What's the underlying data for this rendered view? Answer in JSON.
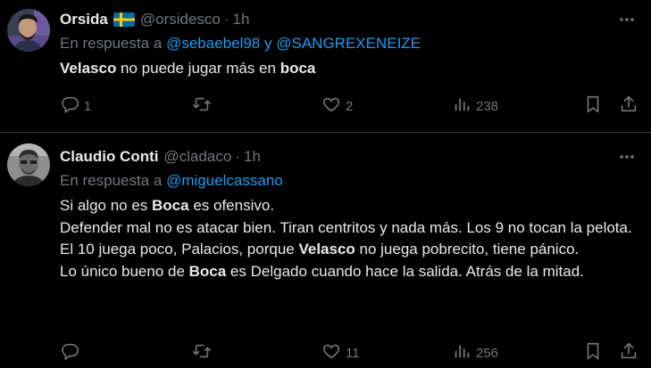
{
  "tweets": [
    {
      "name": "Orsida",
      "handle": "@orsidesco",
      "dot": "·",
      "time": "1h",
      "reply_prefix": "En respuesta a",
      "reply_to_1": "@sebaebel98",
      "reply_conj": "y",
      "reply_to_2": "@SANGREXENEIZE",
      "text_b1": "Velasco",
      "text_1": " no puede jugar más en ",
      "text_b2": "boca",
      "reply_count": "1",
      "retweet_count": "",
      "like_count": "2",
      "view_count": "238",
      "flag_icon": "sweden-flag-icon"
    },
    {
      "name": "Claudio Conti",
      "handle": "@cladaco",
      "dot": "·",
      "time": "1h",
      "reply_prefix": "En respuesta a",
      "reply_to_1": "@miguelcassano",
      "line1_a": "Si algo no es ",
      "line1_b": "Boca",
      "line1_c": " es ofensivo.",
      "line2_a": "Defender mal no es atacar bien. Tiran centritos y nada más. Los 9 no tocan la pelota. El 10 juega poco, Palacios, porque ",
      "line2_b": "Velasco",
      "line2_c": " no juega pobrecito, tiene pánico.",
      "line3_a": "Lo único bueno de ",
      "line3_b": "Boca",
      "line3_c": " es Delgado cuando hace la salida. Atrás de la mitad.",
      "reply_count": "",
      "retweet_count": "",
      "like_count": "11",
      "view_count": "256"
    }
  ],
  "colors": {
    "background": "#000000",
    "text": "#e7e9ea",
    "muted": "#71767b",
    "link": "#1d9bf0",
    "divider": "#2f3336"
  }
}
